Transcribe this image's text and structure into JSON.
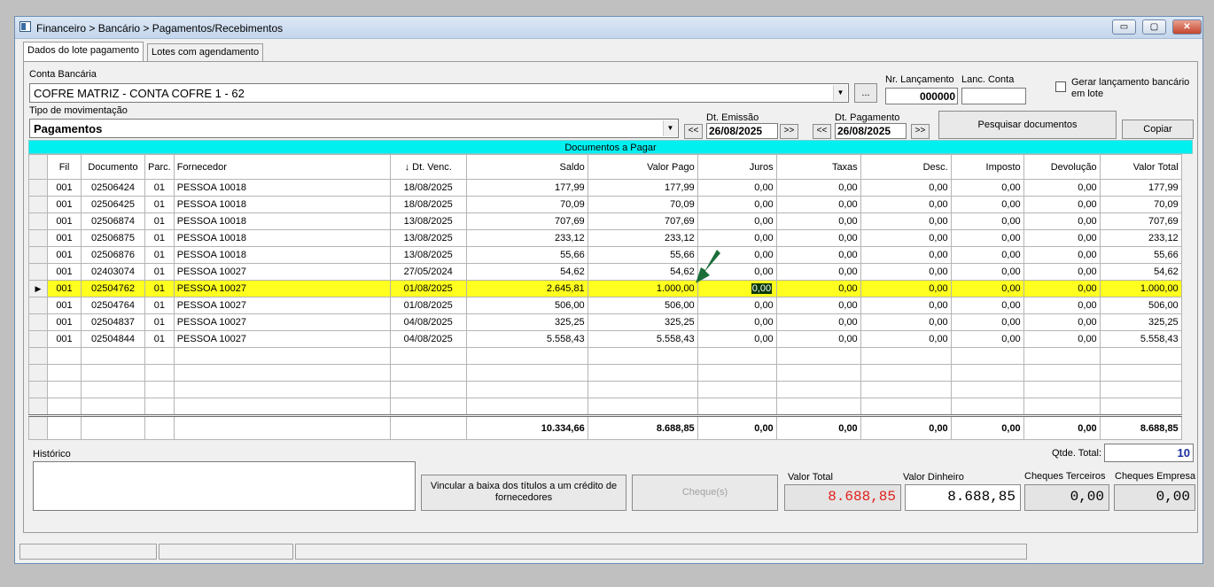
{
  "window": {
    "title": "Financeiro > Bancário > Pagamentos/Recebimentos",
    "min": "▭",
    "max": "▢",
    "close": "✕"
  },
  "tabs": [
    {
      "label": "Dados do lote pagamento",
      "active": true
    },
    {
      "label": "Lotes com agendamento",
      "active": false
    }
  ],
  "form": {
    "conta_label": "Conta Bancária",
    "conta_value": "COFRE MATRIZ - CONTA COFRE 1 - 62",
    "ellipsis": "...",
    "nr_lanc_label": "Nr. Lançamento",
    "nr_lanc_value": "000000",
    "lanc_conta_label": "Lanc. Conta",
    "lanc_conta_value": "",
    "gerar_label_1": "Gerar lançamento bancário",
    "gerar_label_2": "em lote",
    "tipo_label": "Tipo de movimentação",
    "tipo_value": "Pagamentos",
    "dt_emissao_label": "Dt. Emissão",
    "dt_emissao_value": "26/08/2025",
    "dt_pagamento_label": "Dt. Pagamento",
    "dt_pagamento_value": "26/08/2025",
    "nav_prev": "<<",
    "nav_next": ">>",
    "pesquisar_label": "Pesquisar documentos",
    "copiar_label": "Copiar"
  },
  "grid": {
    "title": "Documentos a Pagar",
    "sort_icon": "↓",
    "columns": [
      "Fil",
      "Documento",
      "Parc.",
      "Fornecedor",
      "Dt. Venc.",
      "Saldo",
      "Valor Pago",
      "Juros",
      "Taxas",
      "Desc.",
      "Imposto",
      "Devolução",
      "Valor Total"
    ],
    "rows": [
      [
        "001",
        "02506424",
        "01",
        "PESSOA 10018",
        "18/08/2025",
        "177,99",
        "177,99",
        "0,00",
        "0,00",
        "0,00",
        "0,00",
        "0,00",
        "177,99"
      ],
      [
        "001",
        "02506425",
        "01",
        "PESSOA 10018",
        "18/08/2025",
        "70,09",
        "70,09",
        "0,00",
        "0,00",
        "0,00",
        "0,00",
        "0,00",
        "70,09"
      ],
      [
        "001",
        "02506874",
        "01",
        "PESSOA 10018",
        "13/08/2025",
        "707,69",
        "707,69",
        "0,00",
        "0,00",
        "0,00",
        "0,00",
        "0,00",
        "707,69"
      ],
      [
        "001",
        "02506875",
        "01",
        "PESSOA 10018",
        "13/08/2025",
        "233,12",
        "233,12",
        "0,00",
        "0,00",
        "0,00",
        "0,00",
        "0,00",
        "233,12"
      ],
      [
        "001",
        "02506876",
        "01",
        "PESSOA 10018",
        "13/08/2025",
        "55,66",
        "55,66",
        "0,00",
        "0,00",
        "0,00",
        "0,00",
        "0,00",
        "55,66"
      ],
      [
        "001",
        "02403074",
        "01",
        "PESSOA 10027",
        "27/05/2024",
        "54,62",
        "54,62",
        "0,00",
        "0,00",
        "0,00",
        "0,00",
        "0,00",
        "54,62"
      ],
      [
        "001",
        "02504762",
        "01",
        "PESSOA 10027",
        "01/08/2025",
        "2.645,81",
        "1.000,00",
        "0,00",
        "0,00",
        "0,00",
        "0,00",
        "0,00",
        "1.000,00"
      ],
      [
        "001",
        "02504764",
        "01",
        "PESSOA 10027",
        "01/08/2025",
        "506,00",
        "506,00",
        "0,00",
        "0,00",
        "0,00",
        "0,00",
        "0,00",
        "506,00"
      ],
      [
        "001",
        "02504837",
        "01",
        "PESSOA 10027",
        "04/08/2025",
        "325,25",
        "325,25",
        "0,00",
        "0,00",
        "0,00",
        "0,00",
        "0,00",
        "325,25"
      ],
      [
        "001",
        "02504844",
        "01",
        "PESSOA 10027",
        "04/08/2025",
        "5.558,43",
        "5.558,43",
        "0,00",
        "0,00",
        "0,00",
        "0,00",
        "0,00",
        "5.558,43"
      ]
    ],
    "selected_row": 6,
    "row_indicator": "▶",
    "totals": [
      "10.334,66",
      "8.688,85",
      "0,00",
      "0,00",
      "0,00",
      "0,00",
      "0,00",
      "8.688,85"
    ]
  },
  "bottom": {
    "historico_label": "Histórico",
    "qtde_label": "Qtde. Total:",
    "qtde_value": "10",
    "vincular_label_1": "Vincular a baixa dos títulos a um crédito de",
    "vincular_label_2": "fornecedores",
    "cheques_label": "Cheque(s)",
    "valor_total_label": "Valor Total",
    "valor_total_value": "8.688,85",
    "valor_dinheiro_label": "Valor Dinheiro",
    "valor_dinheiro_value": "8.688,85",
    "cheques_terceiros_label": "Cheques Terceiros",
    "cheques_terceiros_value": "0,00",
    "cheques_empresa_label": "Cheques Empresa",
    "cheques_empresa_value": "0,00"
  },
  "colors": {
    "grid_header": "#00f0f0",
    "selected_row": "#ffff20",
    "valor_total": "#e0201a",
    "qtde": "#1a2ea0",
    "arrow": "#1b6e3a"
  }
}
